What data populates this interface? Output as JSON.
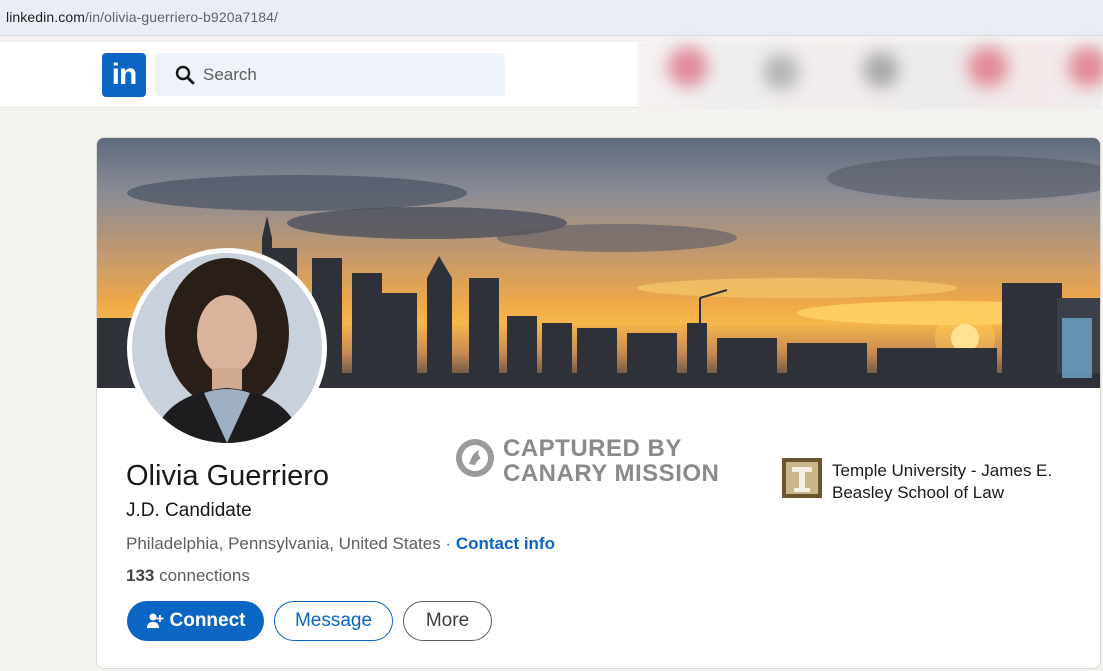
{
  "browser": {
    "url_host": "linkedin.com",
    "url_path": "/in/olivia-guerriero-b920a7184/"
  },
  "header": {
    "logo_text": "in",
    "search_placeholder": "Search"
  },
  "profile": {
    "name": "Olivia Guerriero",
    "headline": "J.D. Candidate",
    "location": "Philadelphia, Pennsylvania, United States",
    "location_separator": " · ",
    "contact_info": "Contact info",
    "connections_count": "133",
    "connections_label": " connections",
    "education": "Temple University - James E. Beasley School of Law"
  },
  "actions": {
    "connect_label": "Connect",
    "message_label": "Message",
    "more_label": "More"
  },
  "watermark": {
    "line1": "CAPTURED BY",
    "line2": "CANARY MISSION"
  },
  "colors": {
    "brand": "#0a66c2",
    "page_bg": "#f3f2ef",
    "text_secondary": "#5e5e5e"
  },
  "icons": {
    "search": "search-icon",
    "connect": "add-person-icon",
    "watermark": "canary-bird-icon"
  }
}
